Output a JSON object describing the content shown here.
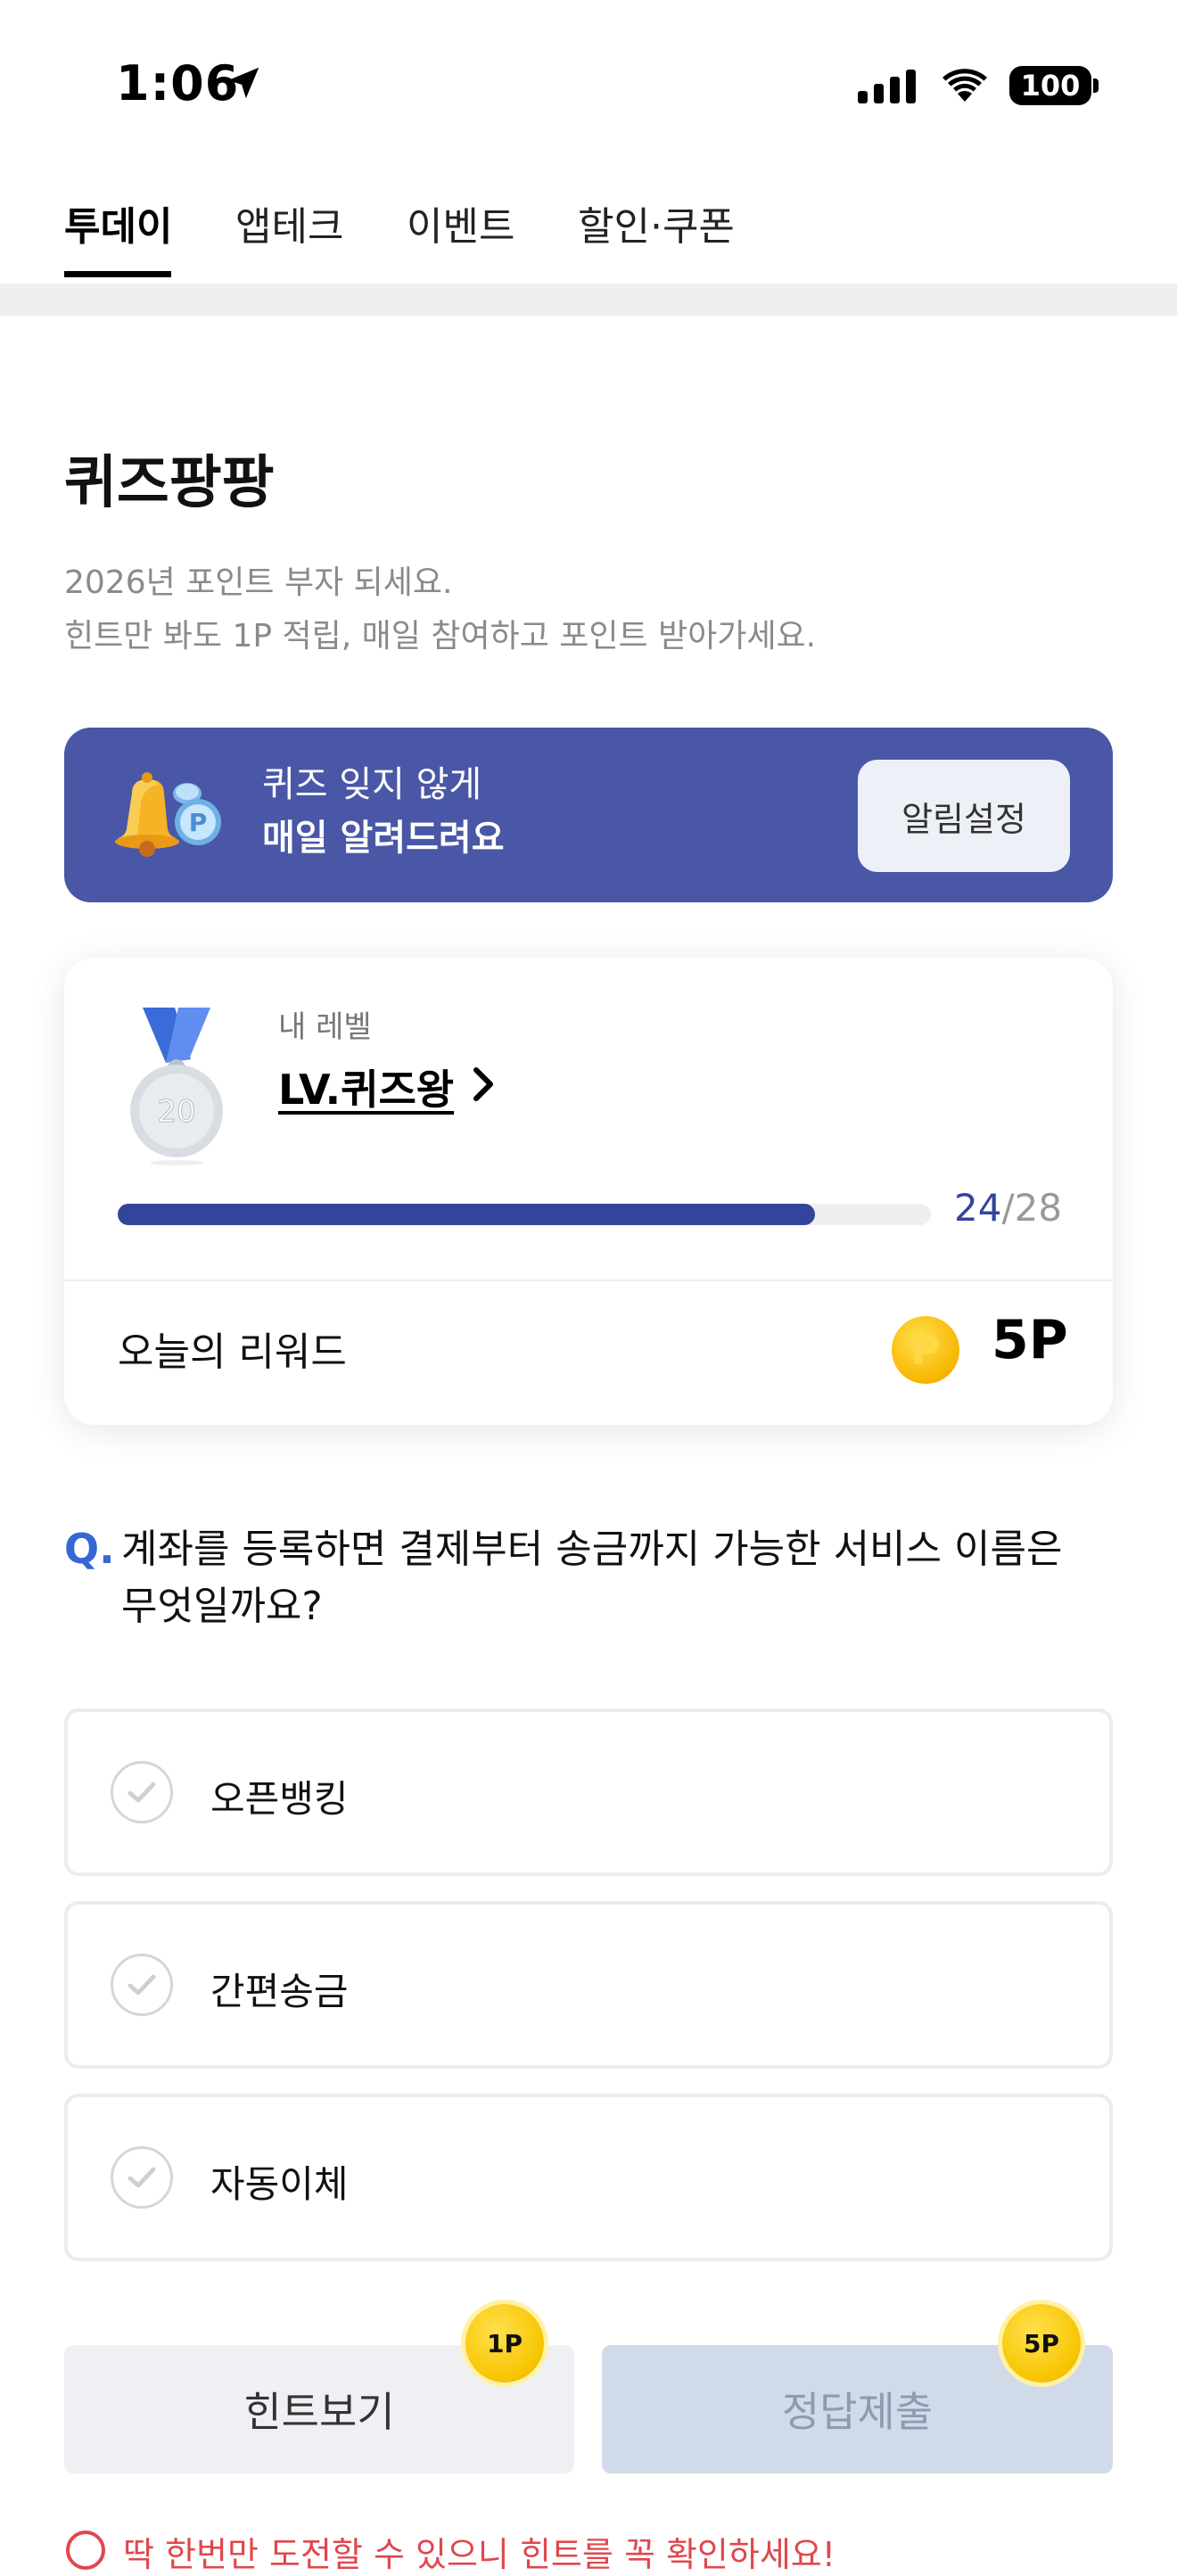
{
  "status_bar": {
    "time": "1:06",
    "battery": "100"
  },
  "tabs": [
    {
      "label": "투데이",
      "active": true
    },
    {
      "label": "앱테크",
      "active": false
    },
    {
      "label": "이벤트",
      "active": false
    },
    {
      "label": "할인·쿠폰",
      "active": false
    }
  ],
  "header": {
    "title": "퀴즈팡팡",
    "subtitle_line1": "2026년 포인트 부자 되세요.",
    "subtitle_line2": "힌트만 봐도 1P 적립, 매일 참여하고 포인트 받아가세요."
  },
  "banner": {
    "line1": "퀴즈 잊지 않게",
    "line2": "매일 알려드려요",
    "button_label": "알림설정",
    "color": "#4957a6"
  },
  "level_card": {
    "label": "내 레벨",
    "level_name": "LV.퀴즈왕",
    "medal_number": "20",
    "progress_current": "24",
    "progress_separator": "/",
    "progress_total": "28",
    "progress_fraction": 0.857,
    "reward_label": "오늘의 리워드",
    "reward_value": "5P",
    "coin_letter": "P"
  },
  "question": {
    "marker": "Q.",
    "text": "계좌를 등록하면 결제부터 송금까지 가능한 서비스 이름은 무엇일까요?"
  },
  "options": [
    {
      "label": "오픈뱅킹"
    },
    {
      "label": "간편송금"
    },
    {
      "label": "자동이체"
    }
  ],
  "buttons": {
    "hint_label": "힌트보기",
    "hint_badge": "1P",
    "submit_label": "정답제출",
    "submit_badge": "5P"
  },
  "warning": "딱 한번만 도전할 수 있으니 힌트를 꼭 확인하세요!",
  "colors": {
    "accent": "#33449b",
    "question": "#3568d4",
    "warning": "#e0474c"
  }
}
